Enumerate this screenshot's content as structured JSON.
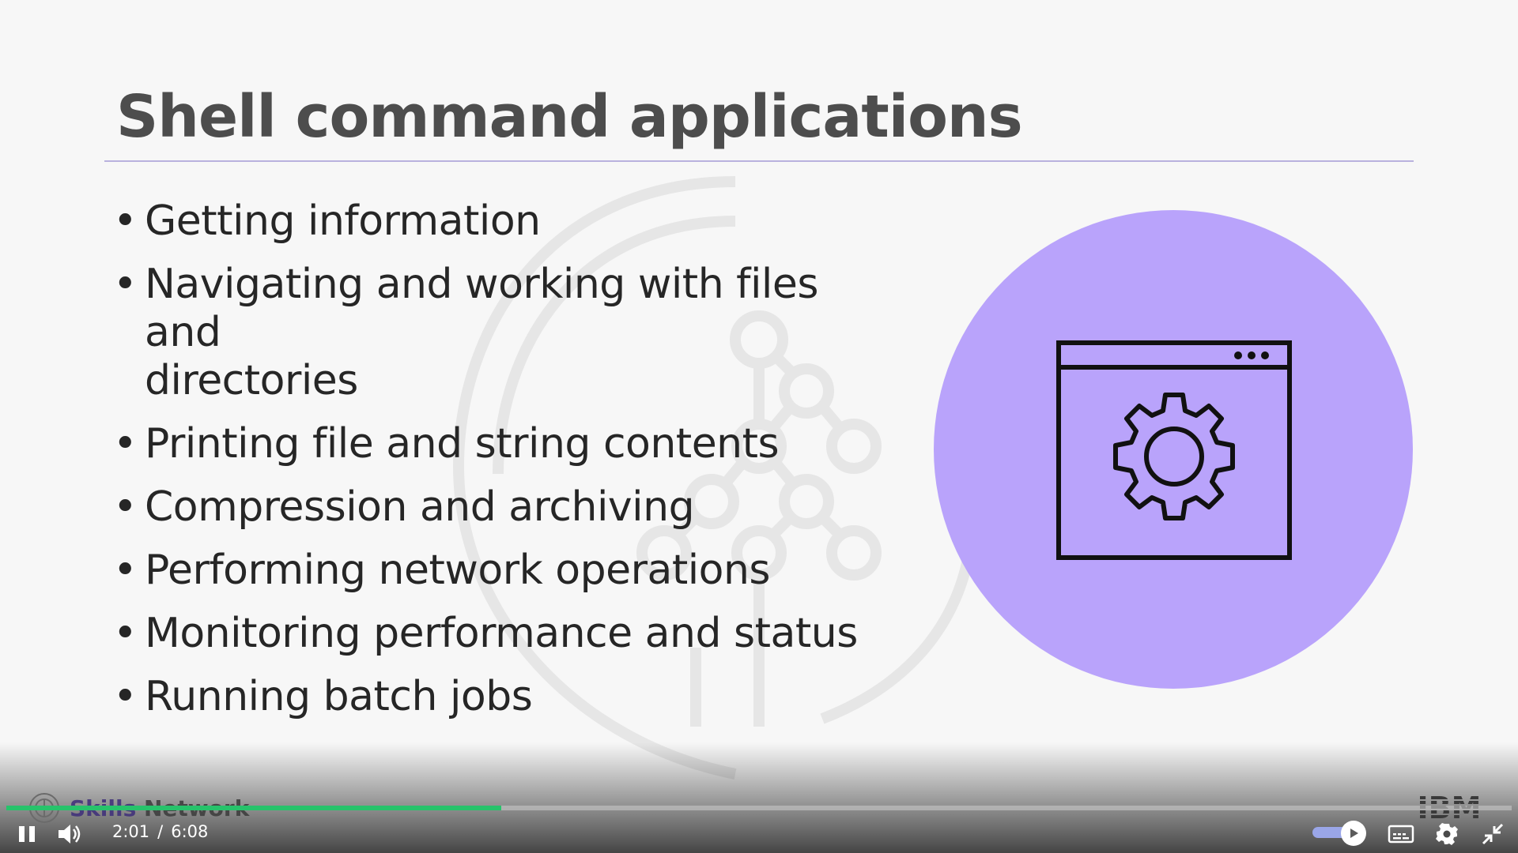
{
  "slide": {
    "title": "Shell command applications",
    "bullets": [
      {
        "line1": "Getting information",
        "line2": ""
      },
      {
        "line1": "Navigating and working with files and",
        "line2": "directories"
      },
      {
        "line1": "Printing file and string contents",
        "line2": ""
      },
      {
        "line1": "Compression and archiving",
        "line2": ""
      },
      {
        "line1": "Performing network operations",
        "line2": ""
      },
      {
        "line1": "Monitoring performance and status",
        "line2": ""
      },
      {
        "line1": "Running batch jobs",
        "line2": ""
      }
    ],
    "bullet_char": "•",
    "illustration": "window-gear-icon",
    "accent_color": "#b9a3fb"
  },
  "branding": {
    "left_logo_text_1": "Skills",
    "left_logo_text_2": "Network",
    "right_logo": "IBM"
  },
  "player": {
    "current_time": "2:01",
    "separator": "/",
    "duration": "6:08",
    "progress_fraction": 0.329,
    "volume_fraction": 0.6,
    "icons": [
      "pause-icon",
      "volume-icon",
      "captions-icon",
      "settings-icon",
      "exit-fullscreen-icon"
    ]
  },
  "colors": {
    "progress_played": "#27c36b",
    "title_text": "#4d4d4d",
    "body_text": "#262626"
  }
}
